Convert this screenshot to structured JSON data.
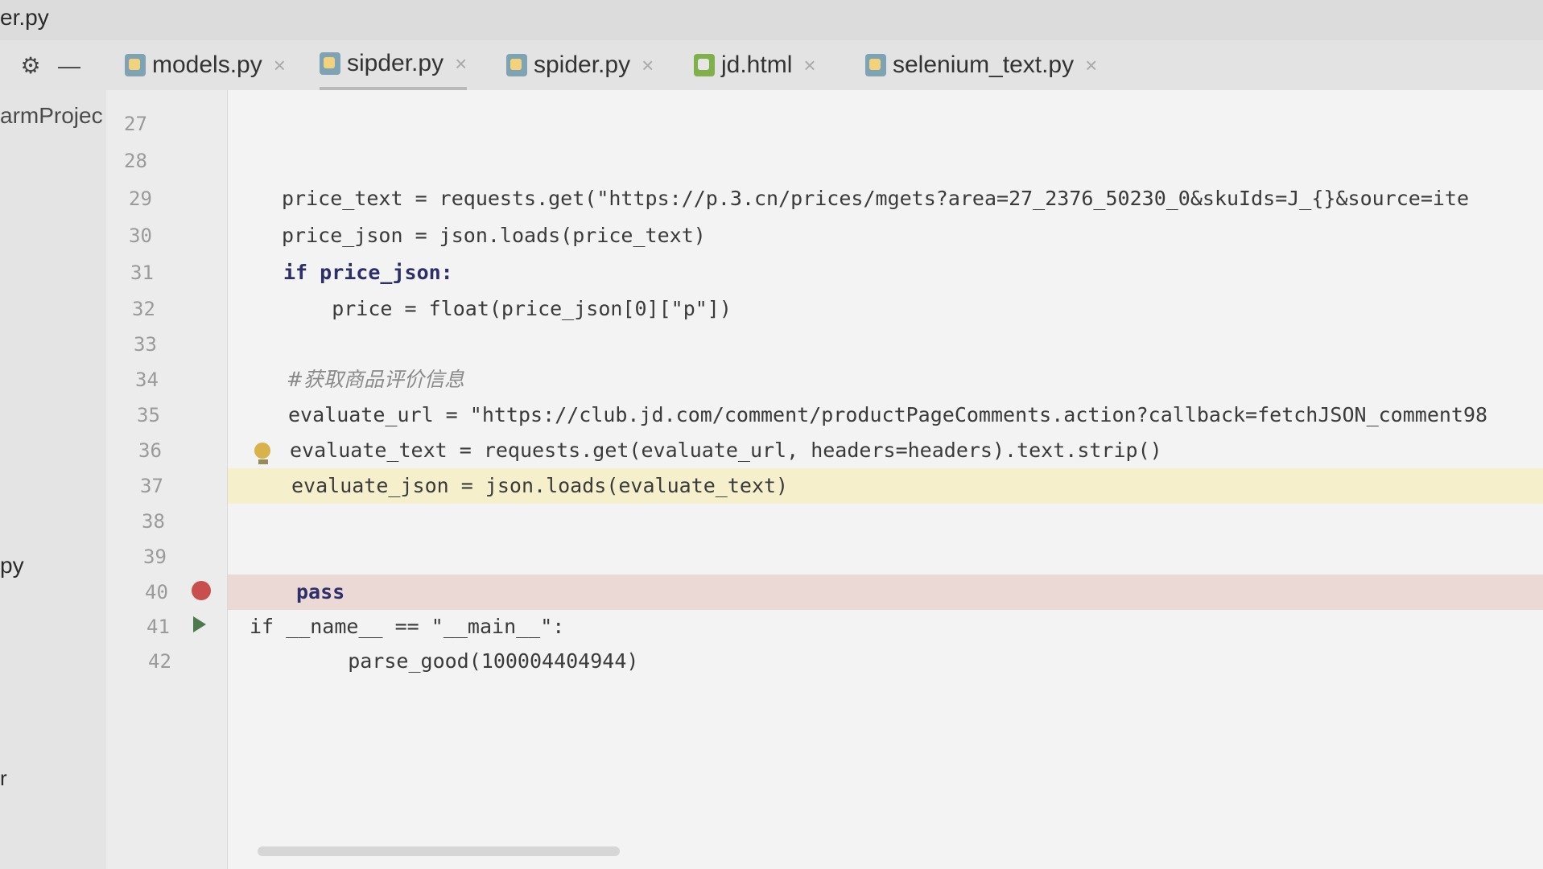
{
  "window": {
    "title": "er.py"
  },
  "toolbar": {
    "settings_icon": "gear-icon",
    "collapse_icon": "minus-icon"
  },
  "tabs": [
    {
      "label": "models.py",
      "icon": "python-file-icon",
      "active": false
    },
    {
      "label": "sipder.py",
      "icon": "python-file-icon",
      "active": true
    },
    {
      "label": "spider.py",
      "icon": "python-file-icon",
      "active": false
    },
    {
      "label": "jd.html",
      "icon": "html-file-icon",
      "active": false
    },
    {
      "label": "selenium_text.py",
      "icon": "python-file-icon",
      "active": false
    }
  ],
  "tab_close_glyph": "×",
  "project_panel": {
    "root_label": "armProjec",
    "item_py": "py",
    "item_r": "r"
  },
  "editor": {
    "lines": [
      {
        "num": "27",
        "code": ""
      },
      {
        "num": "28",
        "code": ""
      },
      {
        "num": "29",
        "code": "price_text = requests.get(\"https://p.3.cn/prices/mgets?area=27_2376_50230_0&skuIds=J_{}&source=ite"
      },
      {
        "num": "30",
        "code": "price_json = json.loads(price_text)"
      },
      {
        "num": "31",
        "code": "if price_json:"
      },
      {
        "num": "32",
        "code": "    price = float(price_json[0][\"p\"])"
      },
      {
        "num": "33",
        "code": ""
      },
      {
        "num": "34",
        "code": "#获取商品评价信息"
      },
      {
        "num": "35",
        "code": "evaluate_url = \"https://club.jd.com/comment/productPageComments.action?callback=fetchJSON_comment98"
      },
      {
        "num": "36",
        "code": "evaluate_text = requests.get(evaluate_url, headers=headers).text.strip()"
      },
      {
        "num": "37",
        "code": "evaluate_json = json.loads(evaluate_text)"
      },
      {
        "num": "38",
        "code": ""
      },
      {
        "num": "39",
        "code": ""
      },
      {
        "num": "40",
        "code": "pass"
      },
      {
        "num": "41",
        "code": "if __name__ == \"__main__\":"
      },
      {
        "num": "42",
        "code": "    parse_good(100004404944)"
      }
    ],
    "highlighted_line": "37",
    "breakpoint_line": "40",
    "intention_bulb_line": "36",
    "run_gutter_line": "41"
  }
}
